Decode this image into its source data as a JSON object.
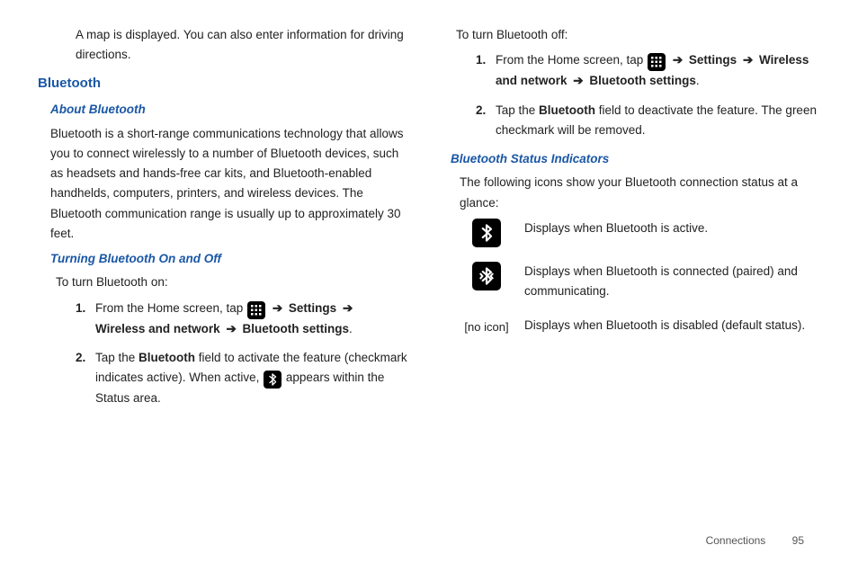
{
  "col1": {
    "intro_hang": "A map is displayed. You can also enter information for driving directions.",
    "h1": "Bluetooth",
    "h2_about": "About Bluetooth",
    "about_body": "Bluetooth is a short-range communications technology that allows you to connect wirelessly to a number of Bluetooth devices, such as headsets and hands-free car kits, and Bluetooth-enabled handhelds, computers, printers, and wireless devices. The Bluetooth communication range is usually up to approximately 30 feet.",
    "h2_onoff": "Turning Bluetooth On and Off",
    "on_intro": "To turn Bluetooth on:",
    "step1_a": "From the Home screen, tap ",
    "step1_b": " Settings ",
    "step1_c": " Wireless and network ",
    "step1_d": " Bluetooth settings",
    "step1_e": ".",
    "step2_a": "Tap the ",
    "step2_b": "Bluetooth",
    "step2_c": " field to activate the feature (checkmark indicates active). When active, ",
    "step2_d": " appears within the Status area."
  },
  "col2": {
    "off_intro": "To turn Bluetooth off:",
    "step1_a": "From the Home screen, tap ",
    "step1_b": " Settings ",
    "step1_c": " Wireless and network ",
    "step1_d": " Bluetooth settings",
    "step1_e": ".",
    "step2_a": "Tap the ",
    "step2_b": "Bluetooth",
    "step2_c": " field to deactivate the feature. The green checkmark will be removed.",
    "h2_status": "Bluetooth Status Indicators",
    "status_intro": "The following icons show your Bluetooth connection status at a glance:",
    "row1": "Displays when Bluetooth is active.",
    "row2": "Displays when Bluetooth is connected (paired) and communicating.",
    "row3_label": "[no icon]",
    "row3": "Displays when Bluetooth is disabled (default status)."
  },
  "arrow": "➔",
  "footer": {
    "section": "Connections",
    "page": "95"
  }
}
